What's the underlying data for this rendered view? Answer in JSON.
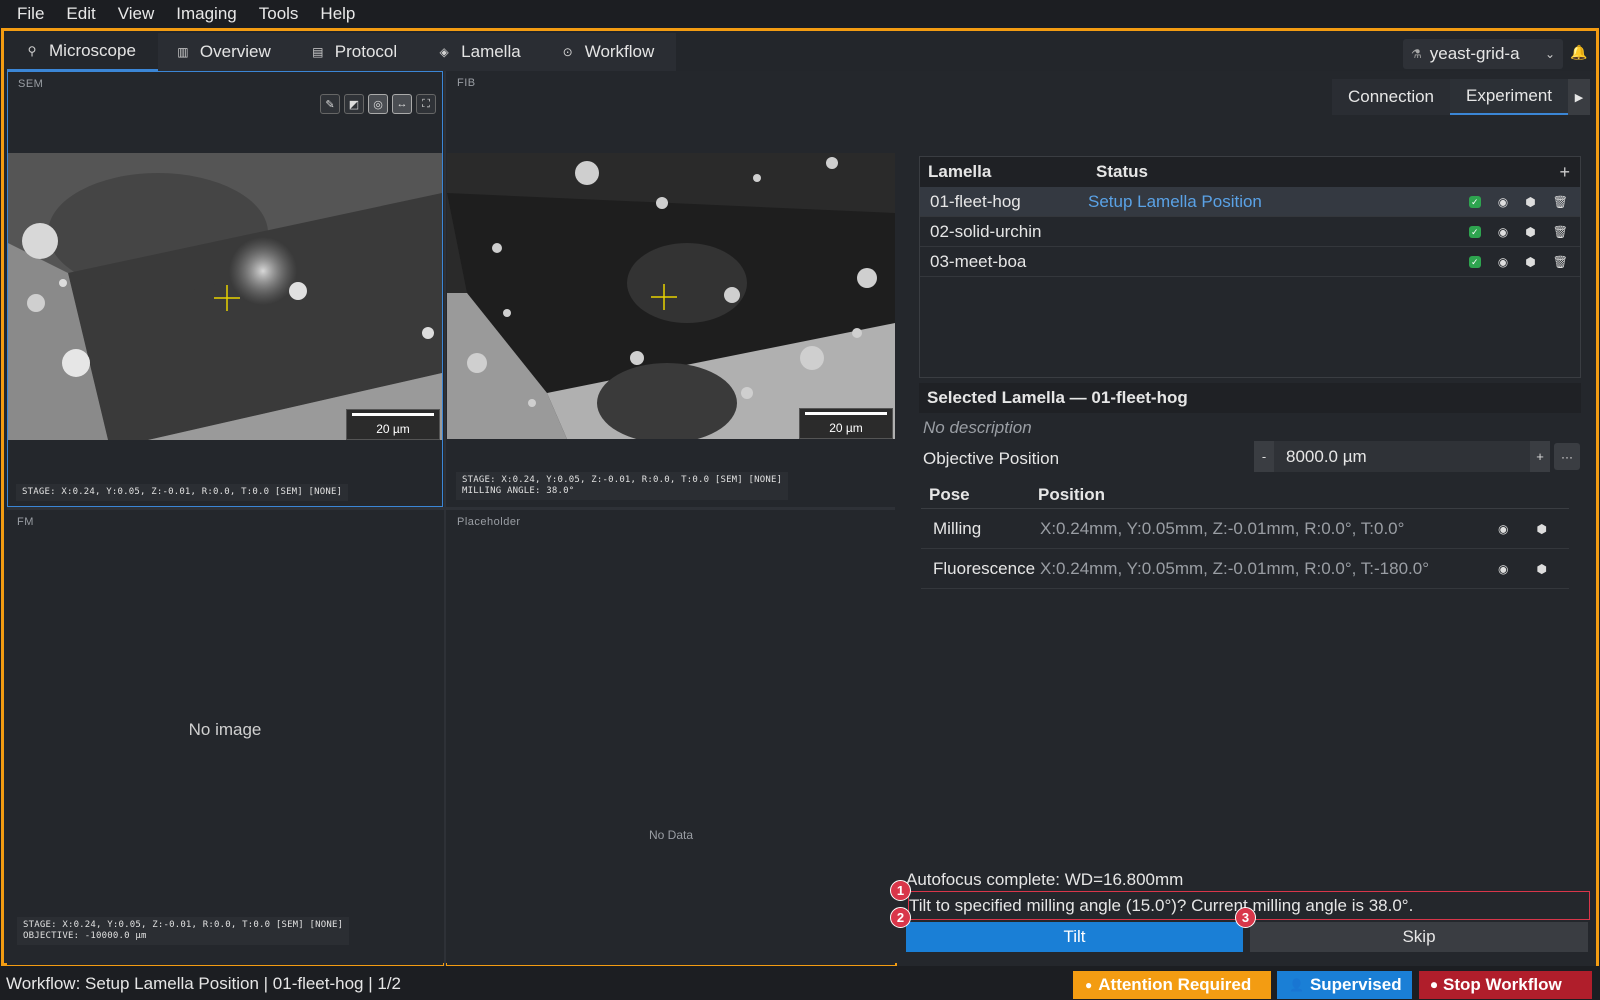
{
  "menu": [
    "File",
    "Edit",
    "View",
    "Imaging",
    "Tools",
    "Help"
  ],
  "tabs": [
    {
      "label": "Microscope",
      "icon": "microscope-icon"
    },
    {
      "label": "Overview",
      "icon": "map-icon"
    },
    {
      "label": "Protocol",
      "icon": "document-icon"
    },
    {
      "label": "Lamella",
      "icon": "layers-icon"
    },
    {
      "label": "Workflow",
      "icon": "play-circle-icon"
    }
  ],
  "grid_selector": {
    "value": "yeast-grid-a",
    "icon": "flask-icon"
  },
  "views": {
    "sem": {
      "label": "SEM",
      "scalebar": "20 µm",
      "stage": "STAGE: X:0.24, Y:0.05, Z:-0.01, R:0.0, T:0.0 [SEM] [NONE]",
      "tools": [
        "pencil-icon",
        "contrast-icon",
        "crosshair-target-icon",
        "measure-icon",
        "fit-screen-icon"
      ]
    },
    "fib": {
      "label": "FIB",
      "scalebar": "20 µm",
      "stage": "STAGE: X:0.24, Y:0.05, Z:-0.01, R:0.0, T:0.0 [SEM] [NONE]",
      "milling": "MILLING ANGLE: 38.0°"
    },
    "fm": {
      "label": "FM",
      "empty": "No image",
      "stage": "STAGE: X:0.24, Y:0.05, Z:-0.01, R:0.0, T:0.0 [SEM] [NONE]",
      "objective": "OBJECTIVE: -10000.0 µm"
    },
    "placeholder": {
      "label": "Placeholder",
      "empty": "No Data"
    }
  },
  "right_tabs": {
    "connection": "Connection",
    "experiment": "Experiment"
  },
  "lamella_table": {
    "headers": {
      "name": "Lamella",
      "status": "Status",
      "add": "+"
    },
    "rows": [
      {
        "name": "01-fleet-hog",
        "status": "Setup Lamella Position",
        "selected": true
      },
      {
        "name": "02-solid-urchin",
        "status": "",
        "selected": false
      },
      {
        "name": "03-meet-boa",
        "status": "",
        "selected": false
      }
    ]
  },
  "selected": {
    "title": "Selected Lamella — 01-fleet-hog",
    "description": "No description",
    "objective_label": "Objective Position",
    "objective_value": "8000.0 µm",
    "minus": "-",
    "plus": "+",
    "more": "···"
  },
  "pose_table": {
    "headers": {
      "pose": "Pose",
      "position": "Position"
    },
    "rows": [
      {
        "pose": "Milling",
        "position": "X:0.24mm, Y:0.05mm, Z:-0.01mm, R:0.0°, T:0.0°"
      },
      {
        "pose": "Fluorescence",
        "position": "X:0.24mm, Y:0.05mm, Z:-0.01mm, R:0.0°, T:-180.0°"
      }
    ]
  },
  "prompt": {
    "autofocus": "Autofocus complete: WD=16.800mm",
    "question": "Tilt to specified milling angle (15.0°)? Current milling angle is 38.0°.",
    "tilt": "Tilt",
    "skip": "Skip",
    "badges": [
      "1",
      "2",
      "3"
    ]
  },
  "status_bar": {
    "workflow": "Workflow: Setup Lamella Position | 01-fleet-hog | 1/2",
    "attention": "Attention Required",
    "supervised": "Supervised",
    "stop": "Stop Workflow"
  },
  "colors": {
    "accent_frame": "#f39c12",
    "primary_blue": "#1a7fd6",
    "danger_red": "#b01e2b",
    "status_link": "#5aa2e6"
  }
}
